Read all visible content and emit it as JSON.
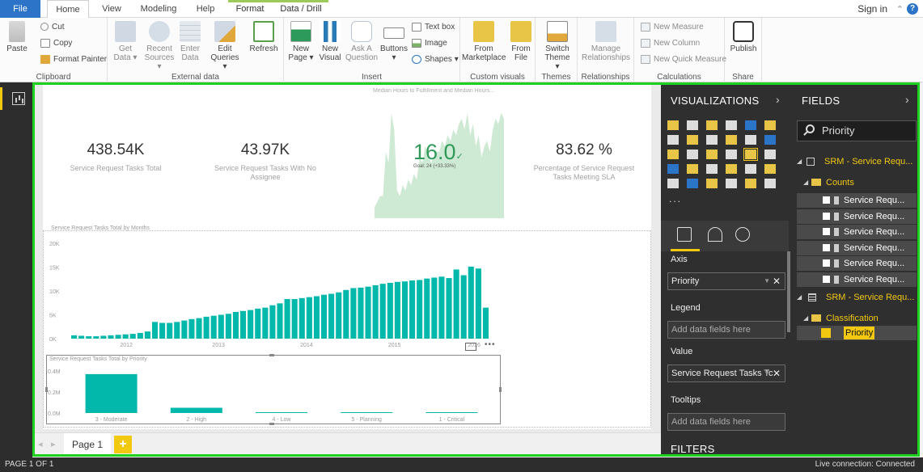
{
  "colors": {
    "accent_teal": "#01b8aa",
    "selection_green": "#1fd11f",
    "pbi_yellow": "#f2c811",
    "file_blue": "#2b74c8"
  },
  "tabs": {
    "file": "File",
    "home": "Home",
    "view": "View",
    "modeling": "Modeling",
    "help": "Help",
    "format": "Format",
    "data_drill": "Data / Drill"
  },
  "account": {
    "sign_in": "Sign in"
  },
  "ribbon": {
    "clipboard": {
      "label": "Clipboard",
      "paste": "Paste",
      "cut": "Cut",
      "copy": "Copy",
      "format_painter": "Format Painter"
    },
    "external": {
      "label": "External data",
      "get_data_1": "Get",
      "get_data_2": "Data ▾",
      "recent_1": "Recent",
      "recent_2": "Sources ▾",
      "enter_1": "Enter",
      "enter_2": "Data",
      "edit_1": "Edit",
      "edit_2": "Queries ▾",
      "refresh": "Refresh"
    },
    "insert": {
      "label": "Insert",
      "new_page_1": "New",
      "new_page_2": "Page ▾",
      "new_visual_1": "New",
      "new_visual_2": "Visual",
      "ask_1": "Ask A",
      "ask_2": "Question",
      "buttons_1": "Buttons",
      "buttons_2": "▾",
      "text_box": "Text box",
      "image": "Image",
      "shapes": "Shapes ▾"
    },
    "custom": {
      "label": "Custom visuals",
      "market_1": "From",
      "market_2": "Marketplace",
      "file_1": "From",
      "file_2": "File"
    },
    "themes": {
      "label": "Themes",
      "switch_1": "Switch",
      "switch_2": "Theme ▾"
    },
    "relationships": {
      "label": "Relationships",
      "manage_1": "Manage",
      "manage_2": "Relationships"
    },
    "calculations": {
      "label": "Calculations",
      "new_measure": "New Measure",
      "new_column": "New Column",
      "new_quick_measure": "New Quick Measure"
    },
    "share": {
      "label": "Share",
      "publish": "Publish"
    }
  },
  "report": {
    "kpis": [
      {
        "value": "438.54K",
        "label": "Service Request Tasks Total"
      },
      {
        "value": "43.97K",
        "label": "Service Request Tasks With No Assignee"
      },
      {
        "value": "83.62 %",
        "label": "Percentage of Service Request Tasks Meeting SLA"
      }
    ],
    "area_title": "Median Hours to Fulfillment and Median Hours...",
    "gauge_value": "16.0",
    "gauge_goal": "Goal: 24 (+33.33%)"
  },
  "chart_data": [
    {
      "type": "area",
      "title": "Median Hours to Fulfillment and Median Hours...",
      "values": [
        0.1,
        0.15,
        0.2,
        0.2,
        0.6,
        0.5,
        0.95,
        0.8,
        0.25,
        0.2,
        0.3,
        0.25,
        0.35,
        0.3,
        0.4,
        0.35,
        0.55,
        0.5,
        0.65,
        0.6,
        0.5,
        0.55,
        0.6,
        0.6,
        0.7,
        0.65,
        0.75,
        0.7,
        0.8,
        0.75,
        0.85,
        0.9,
        0.8,
        0.95,
        0.75,
        0.85,
        0.65,
        0.75,
        0.55,
        0.65,
        0.7,
        0.6,
        0.8,
        0.9,
        0.85,
        0.95,
        0.9
      ],
      "xlabel": "",
      "ylabel": ""
    },
    {
      "type": "bar",
      "title": "Service Request Tasks Total by Months",
      "x_ticks": [
        "2012",
        "2013",
        "2014",
        "2015",
        "2016"
      ],
      "y_ticks": [
        "20K",
        "15K",
        "10K",
        "5K",
        "0K"
      ],
      "ylim": [
        0,
        20000
      ],
      "values": [
        700,
        600,
        500,
        500,
        600,
        700,
        800,
        900,
        1000,
        1200,
        1500,
        3500,
        3300,
        3300,
        3500,
        3800,
        4100,
        4300,
        4600,
        4800,
        5000,
        5200,
        5600,
        5800,
        6000,
        6300,
        6500,
        7000,
        7400,
        8300,
        8300,
        8500,
        8700,
        8900,
        9200,
        9400,
        9700,
        10200,
        10600,
        10700,
        10900,
        11200,
        11500,
        11700,
        11900,
        12000,
        12200,
        12300,
        12600,
        12800,
        13000,
        12700,
        14500,
        13300,
        15100,
        14700,
        6500
      ]
    },
    {
      "type": "bar",
      "title": "Service Request Tasks Total by Priority",
      "categories": [
        "3 - Moderate",
        "2 - High",
        "4 - Low",
        "5 - Planning",
        "1 - Critical"
      ],
      "values": [
        0.37,
        0.05,
        0.003,
        0.002,
        0.002
      ],
      "y_ticks": [
        "0.4M",
        "0.2M",
        "0.0M"
      ],
      "ylim": [
        0,
        0.4
      ]
    }
  ],
  "pages": {
    "page1": "Page 1",
    "add": "+"
  },
  "visualizations": {
    "title": "VISUALIZATIONS",
    "more": "...",
    "wells": {
      "axis_label": "Axis",
      "axis_value": "Priority",
      "legend_label": "Legend",
      "legend_placeholder": "Add data fields here",
      "value_label": "Value",
      "value_value": "Service Request Tasks Tc",
      "tooltips_label": "Tooltips",
      "tooltips_placeholder": "Add data fields here"
    },
    "filters": "FILTERS"
  },
  "fields": {
    "title": "FIELDS",
    "search_value": "Priority",
    "table1": "SRM - Service Requ...",
    "folder_counts": "Counts",
    "measures": [
      "Service Requ...",
      "Service Requ...",
      "Service Requ...",
      "Service Requ...",
      "Service Requ...",
      "Service Requ..."
    ],
    "table2": "SRM - Service Requ...",
    "folder_class": "Classification",
    "priority": "Priority"
  },
  "status": {
    "page": "PAGE 1 OF 1",
    "connection": "Live connection: Connected"
  }
}
